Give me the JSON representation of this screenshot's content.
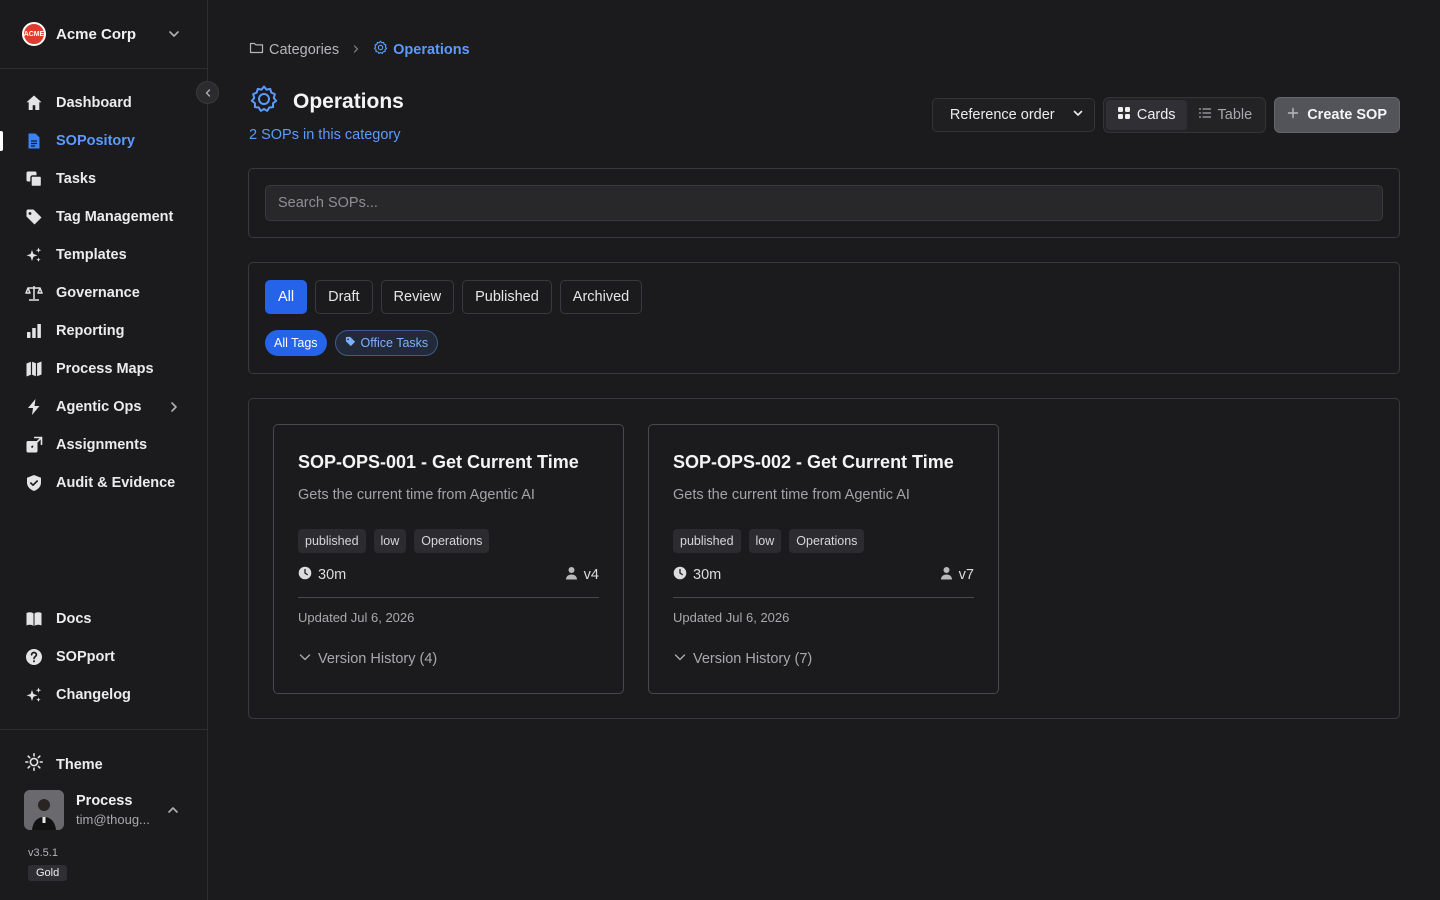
{
  "org": {
    "name": "Acme Corp",
    "logo_text": "ACME"
  },
  "nav": {
    "top": [
      {
        "label": "Dashboard",
        "icon": "home-icon"
      },
      {
        "label": "SOPository",
        "icon": "document-icon",
        "active": true
      },
      {
        "label": "Tasks",
        "icon": "tasks-icon"
      },
      {
        "label": "Tag Management",
        "icon": "tag-icon"
      },
      {
        "label": "Templates",
        "icon": "sparkles-icon"
      },
      {
        "label": "Governance",
        "icon": "scale-icon"
      },
      {
        "label": "Reporting",
        "icon": "bar-chart-icon"
      },
      {
        "label": "Process Maps",
        "icon": "map-icon"
      },
      {
        "label": "Agentic Ops",
        "icon": "bolt-icon",
        "has_submenu": true
      },
      {
        "label": "Assignments",
        "icon": "assign-icon"
      },
      {
        "label": "Audit & Evidence",
        "icon": "shield-check-icon"
      }
    ],
    "bottom": [
      {
        "label": "Docs",
        "icon": "book-icon"
      },
      {
        "label": "SOPport",
        "icon": "help-icon"
      },
      {
        "label": "Changelog",
        "icon": "sparkles-icon"
      }
    ]
  },
  "theme_label": "Theme",
  "user": {
    "name": "Process",
    "email": "tim@thoug..."
  },
  "app_version": "v3.5.1",
  "tier": "Gold",
  "breadcrumb": {
    "root": "Categories",
    "current": "Operations"
  },
  "page": {
    "title": "Operations",
    "subtitle": "2 SOPs in this category"
  },
  "sort": {
    "selected": "Reference order"
  },
  "view": {
    "cards_label": "Cards",
    "table_label": "Table",
    "active": "cards"
  },
  "create_button": "Create SOP",
  "search": {
    "placeholder": "Search SOPs...",
    "value": ""
  },
  "status_filters": [
    {
      "label": "All",
      "active": true
    },
    {
      "label": "Draft"
    },
    {
      "label": "Review"
    },
    {
      "label": "Published"
    },
    {
      "label": "Archived"
    }
  ],
  "tag_filters": {
    "all_label": "All Tags",
    "tags": [
      "Office Tasks"
    ]
  },
  "sops": [
    {
      "title": "SOP-OPS-001 - Get Current Time",
      "description": "Gets the current time from Agentic AI",
      "badges": [
        "published",
        "low",
        "Operations"
      ],
      "duration": "30m",
      "version": "v4",
      "updated": "Updated Jul 6, 2026",
      "version_history": "Version History (4)"
    },
    {
      "title": "SOP-OPS-002 - Get Current Time",
      "description": "Gets the current time from Agentic AI",
      "badges": [
        "published",
        "low",
        "Operations"
      ],
      "duration": "30m",
      "version": "v7",
      "updated": "Updated Jul 6, 2026",
      "version_history": "Version History (7)"
    }
  ],
  "colors": {
    "accent": "#2563eb",
    "link": "#5b9bff",
    "background": "#1b1b1d",
    "border": "#3a3a3e"
  }
}
